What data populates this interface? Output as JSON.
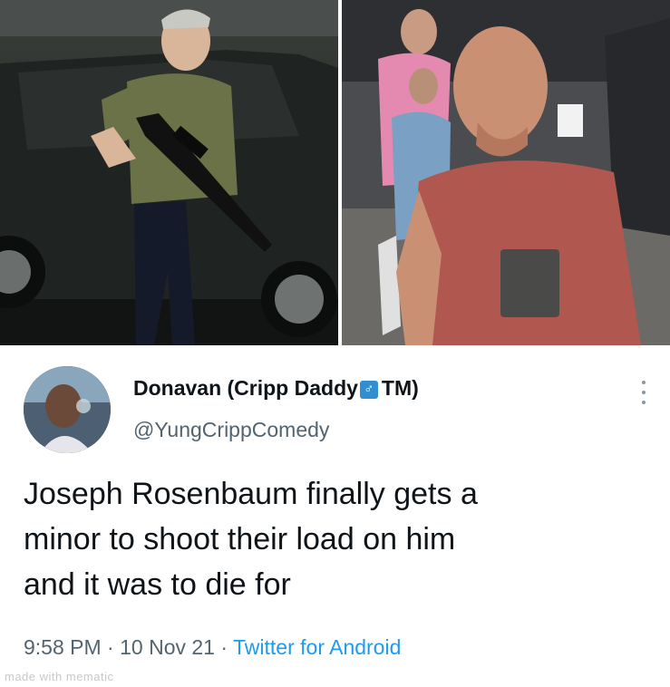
{
  "photos": {
    "left_icon": "photo-of-armed-teen",
    "right_icon": "photo-of-bald-man"
  },
  "tweet": {
    "avatar_icon": "user-avatar",
    "display_name": "Donavan (Cripp Daddy",
    "badge_icon": "male-sign-icon",
    "badge_glyph": "♂",
    "display_name_suffix": "TM)",
    "handle": "@YungCrippComedy",
    "text_lines": [
      "Joseph Rosenbaum finally gets a",
      "minor to shoot their load on him",
      "and it was to die for"
    ],
    "time": "9:58 PM",
    "separator": "·",
    "date": "10 Nov 21",
    "source": "Twitter for Android",
    "more_icon": "more-options-icon"
  },
  "watermark": "made with mematic",
  "colors": {
    "name": "#0f1419",
    "secondary": "#536471",
    "link": "#1d9bf0",
    "badge": "#2f8fd0"
  }
}
